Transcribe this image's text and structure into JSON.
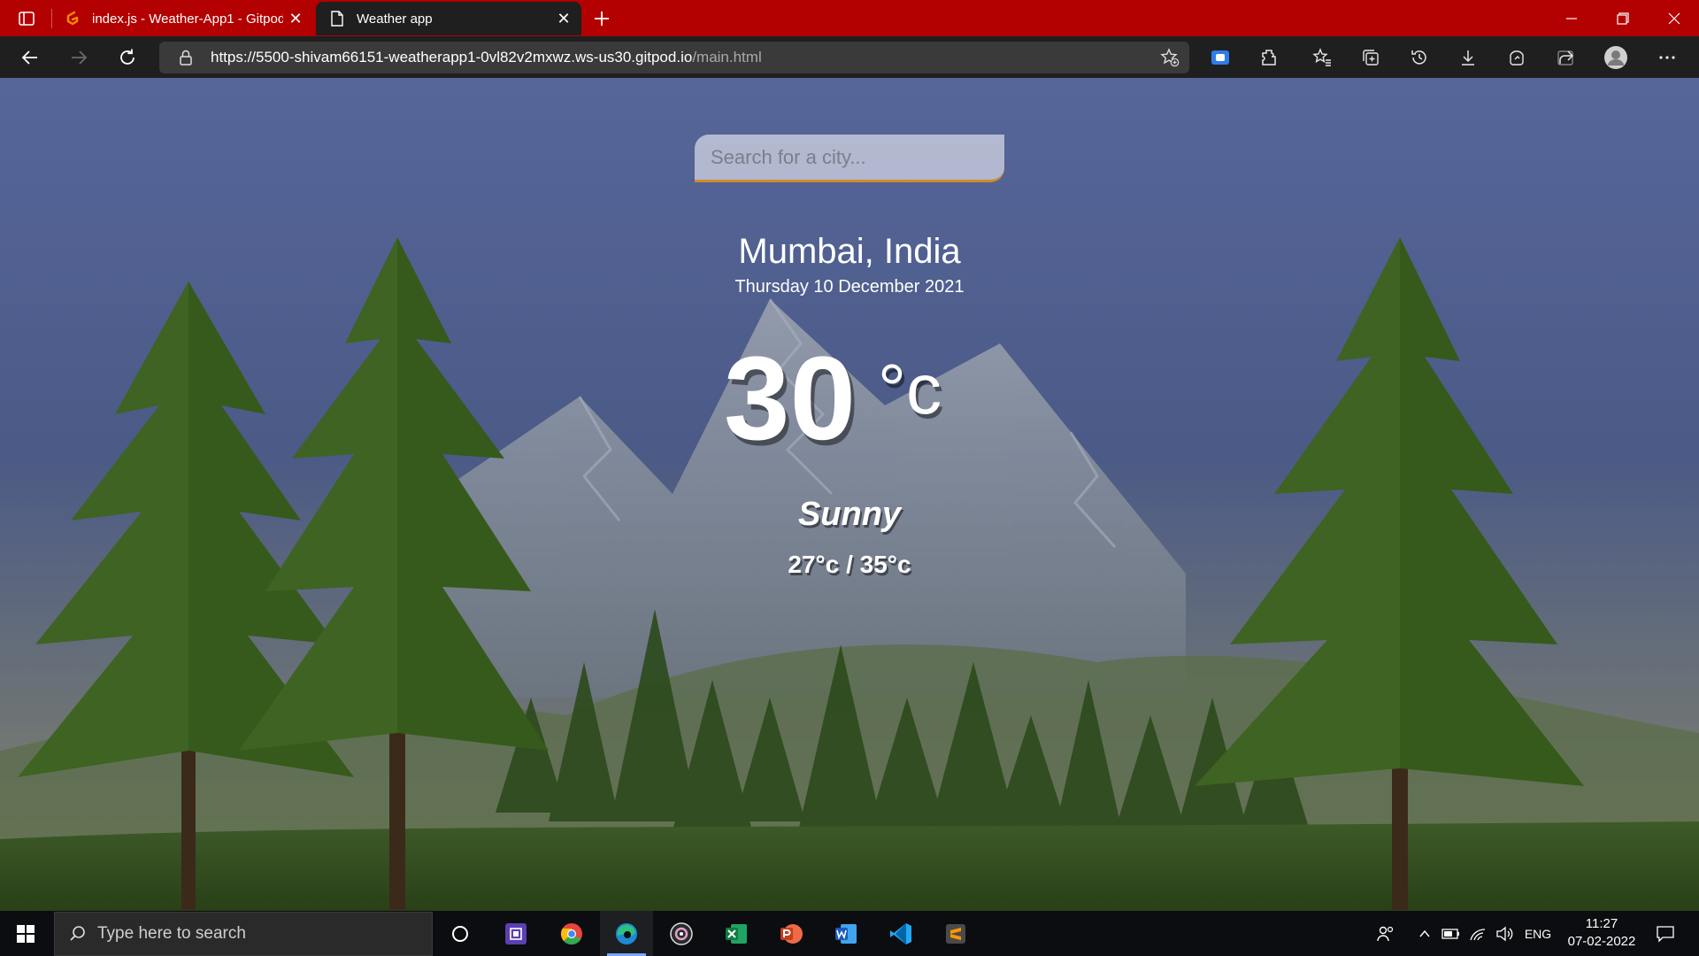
{
  "browser": {
    "tabs": [
      {
        "title": "index.js - Weather-App1 - Gitpod",
        "active": false
      },
      {
        "title": "Weather app",
        "active": true
      }
    ],
    "url_host": "https://5500-shivam66151-weatherapp1-0vl82v2mxwz.ws-us30.gitpod.io",
    "url_path": "/main.html"
  },
  "weather_app": {
    "search_placeholder": "Search for a city...",
    "city": "Mumbai, India",
    "date": "Thursday 10 December 2021",
    "temperature": "30",
    "temperature_unit": "°c",
    "condition": "Sunny",
    "hi_lo": "27°c / 35°c"
  },
  "taskbar": {
    "search_placeholder": "Type here to search",
    "language": "ENG",
    "time": "11:27",
    "date": "07-02-2022",
    "pinned_apps": [
      "task-view",
      "cpu-app",
      "chrome",
      "edge",
      "obs",
      "excel",
      "powerpoint",
      "word",
      "vscode",
      "sublime-text"
    ]
  },
  "colors": {
    "tabbar": "#b30000",
    "toolbar": "#1f1f1f",
    "taskbar": "#0b0d10",
    "search_underline": "#d08a2b"
  }
}
